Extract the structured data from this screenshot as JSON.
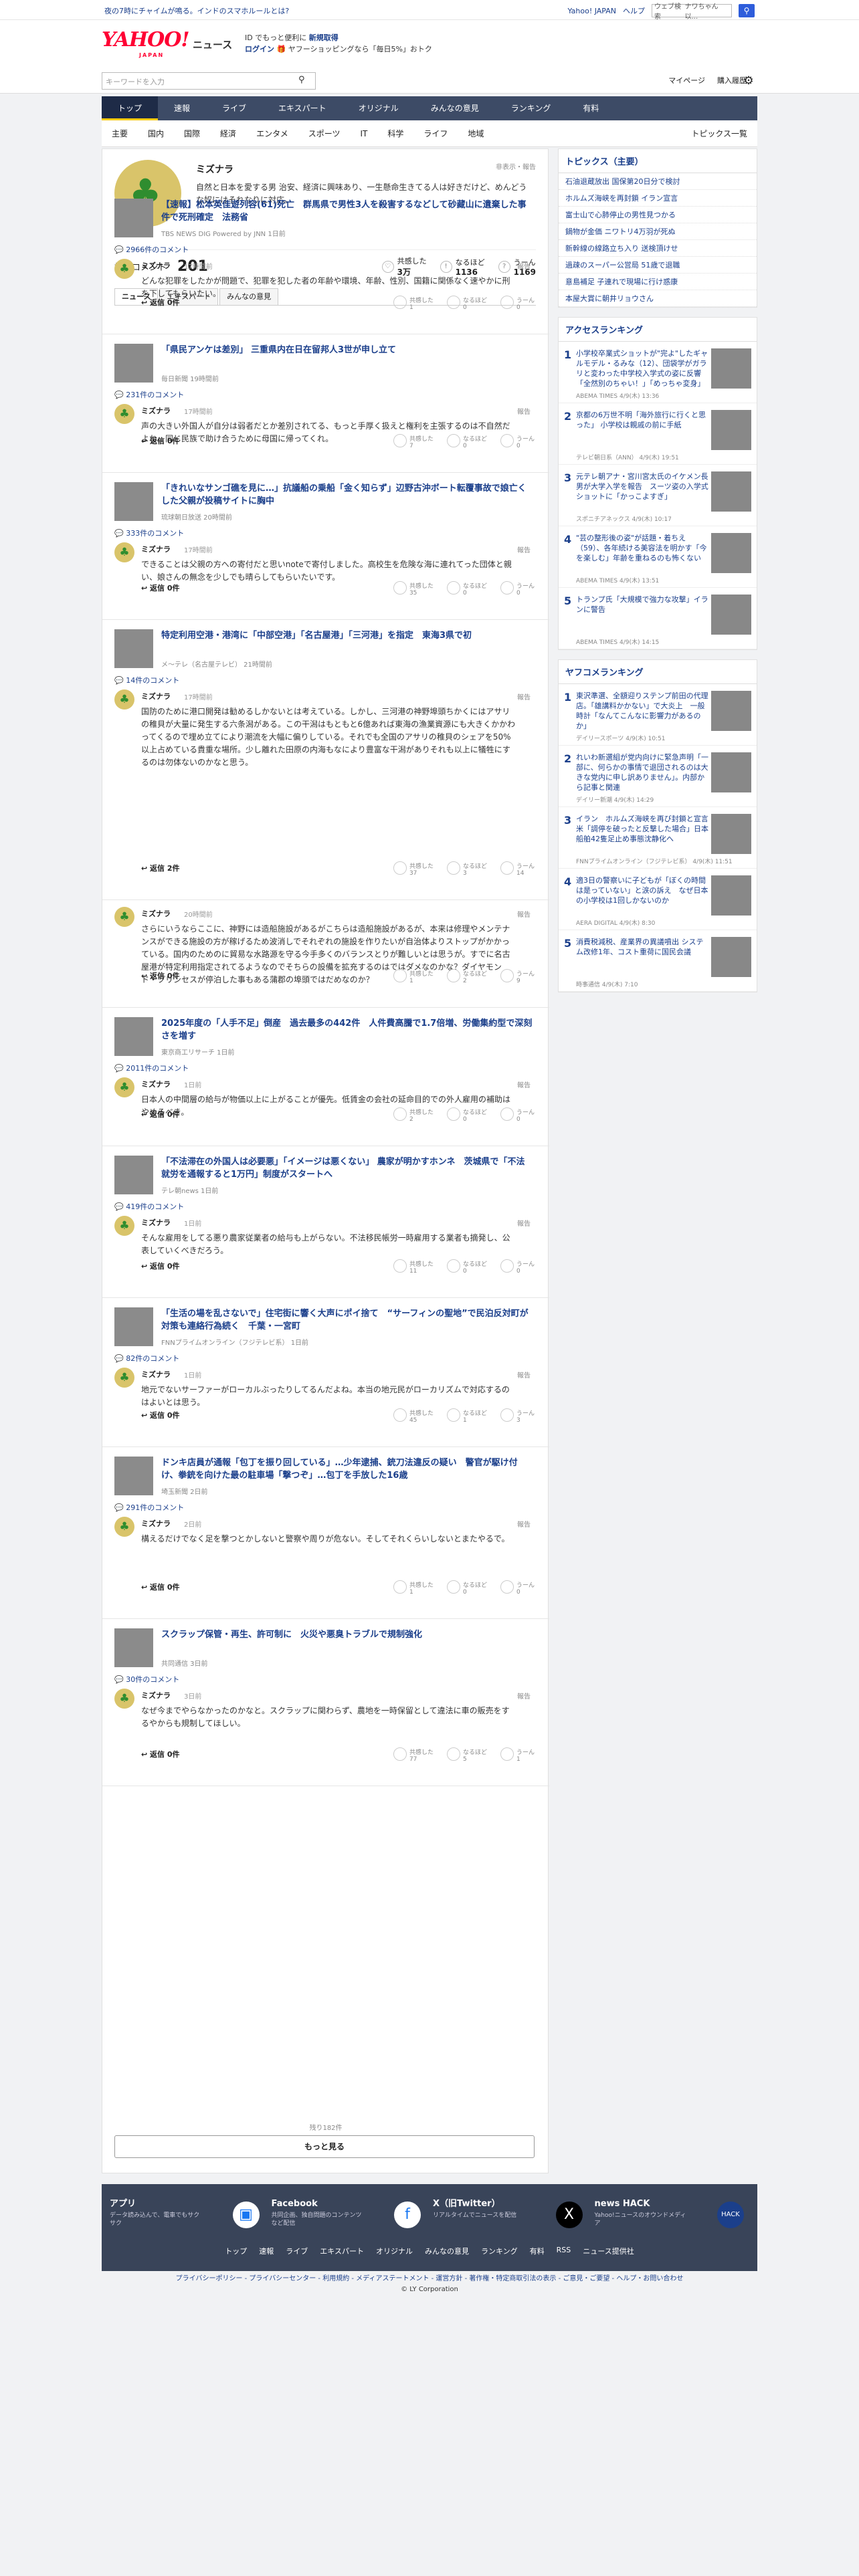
{
  "topbar": {
    "promo": "夜の7時にチャイムが鳴る。インドのスマホルールとは?",
    "links": [
      "Yahoo! JAPAN",
      "ヘルプ"
    ],
    "search_placeholder": "ウェブ検索",
    "search_value": "ナワちゃん 以..."
  },
  "header": {
    "logo": "YAHOO!",
    "logo_sub": "JAPAN",
    "service": "ニュース",
    "tag1": "ID でもっと便利に",
    "tag1_link": "新規取得",
    "tag2_login": "ログイン",
    "tag2": "ヤフーショッピングなら「毎日5%」おトク"
  },
  "search": {
    "placeholder": "キーワードを入力",
    "links": [
      "マイページ",
      "購入履歴"
    ]
  },
  "gnav": [
    "トップ",
    "速報",
    "ライブ",
    "エキスパート",
    "オリジナル",
    "みんなの意見",
    "ランキング",
    "有料"
  ],
  "snav": [
    "主要",
    "国内",
    "国際",
    "経済",
    "エンタメ",
    "スポーツ",
    "IT",
    "科学",
    "ライフ",
    "地域"
  ],
  "snav_all": "トピックス一覧",
  "profile": {
    "name": "ミズナラ",
    "report": "非表示・報告",
    "bio": "自然と日本を愛する男 治安、経済に興味あり、一生懸命生きてる人は好きだけど、めんどうな奴にはそれなりに対応。",
    "comments_label": "投稿コメント",
    "comments_count": "201",
    "reactions": [
      {
        "label": "共感した",
        "count": "3万"
      },
      {
        "label": "なるほど",
        "count": "1136"
      },
      {
        "label": "うーん",
        "count": "1169"
      }
    ]
  },
  "tabs": [
    "ニュース",
    "エキスパート",
    "みんなの意見"
  ],
  "reaction_labels": [
    "共感した",
    "なるほど",
    "うーん"
  ],
  "items": [
    {
      "title": "【速報】松本英佳遊列容(61)死亡　群馬県で男性3人を殺害するなどして砂藏山に遺棄した事件で死刑確定　法務省",
      "source": "TBS NEWS DIG Powered by JNN 1日前",
      "count": "2966件のコメント",
      "user": "ミズナラ",
      "time": "17時間前",
      "body": "どんな犯罪をしたかが問題で、犯罪を犯した者の年齢や環境、年齢、性別、国籍に関係なく速やかに刑を下してもらいたい。",
      "reply": "返信 0件",
      "r": [
        "1",
        "0",
        "0"
      ]
    },
    {
      "title": "「県民アンケは差別」 三重県内在日在留邦人3世が申し立て",
      "source": "毎日新聞 19時間前",
      "count": "231件のコメント",
      "user": "ミズナラ",
      "time": "17時間前",
      "body": "声の大きい外国人が自分は弱者だとか差別されてる、もっと手厚く扱えと権利を主張するのは不自然だよね。同じ民族で助け合うために母国に帰ってくれ。",
      "reply": "返信 0件",
      "r": [
        "7",
        "0",
        "0"
      ]
    },
    {
      "title": "「きれいなサンゴ礁を見に…」抗議船の乗船「金く知らず」辺野古沖ボート転覆事故で娘亡くした父親が投稿サイトに胸中",
      "source": "琉球朝日放送 20時間前",
      "count": "333件のコメント",
      "user": "ミズナラ",
      "time": "17時間前",
      "body": "できることは父親の方への寄付だと思いnoteで寄付しました。高校生を危険な海に連れてった団体と親い、娘さんの無念を少しでも晴らしてもらいたいです。",
      "reply": "返信 0件",
      "r": [
        "35",
        "0",
        "0"
      ]
    },
    {
      "title": "特定利用空港・港湾に「中部空港」「名古屋港」「三河港」を指定　東海3県で初",
      "source": "メ～テレ（名古屋テレビ） 21時間前",
      "count": "14件のコメント",
      "user": "ミズナラ",
      "time": "17時間前",
      "body": "国防のために港口開発は勧めるしかないとは考えている。しかし、三河港の神野埠頭ちかくにはアサリの稚貝が大量に発生する六条潟がある。この干潟はもともと6億あれば東海の漁業資源にも大きくかかわってくるので埋め立てにより潮流を大幅に偏りしている。それでも全国のアサリの稚貝のシェアを50%以上占めている貴重な場所。少し離れた田原の内海もなにより豊富な干潟がありそれも以上に犠牲にするのは勿体ないのかなと思う。",
      "reply": "返信 2件",
      "r": [
        "37",
        "3",
        "14"
      ]
    },
    {
      "title": "",
      "source": "",
      "count": "",
      "user": "ミズナラ",
      "time": "20時間前",
      "body": "さらにいうならここに、神野には造船施設があるがこちらは造船施設があるが、本来は修理やメンテナンスができる施設の方が稼げるため波消しでそれぞれの施設を作りたいが自治体よりストップがかかっている。国内のためのに貿易な水路源を守る今手多くのバランスとりが難しいとは思うが。すでに名古屋港が特定利用指定されてるようなのでそちらの設備を拡充するのはではダメなのかな？ダイヤモンド・プリンセスが停泊した事もある蒲郡の埠頭ではだめなのか？",
      "reply": "返信 0件",
      "r": [
        "1",
        "2",
        "9"
      ]
    },
    {
      "title": "2025年度の「人手不足」倒産　過去最多の442件　人件費高騰で1.7倍増、労働集約型で深刻さを増す",
      "source": "東京商工リサーチ 1日前",
      "count": "2011件のコメント",
      "user": "ミズナラ",
      "time": "1日前",
      "body": "日本人の中間層の給与が物価以上に上がることが優先。低賃金の会社の延命目的での外人雇用の補助はやめるべき。",
      "reply": "返信 0件",
      "r": [
        "2",
        "0",
        "0"
      ]
    },
    {
      "title": "「不法滞在の外国人は必要悪」「イメージは悪くない」 農家が明かすホンネ　茨城県で「不法就労を通報すると1万円」制度がスタートへ",
      "source": "テレ朝news 1日前",
      "count": "419件のコメント",
      "user": "ミズナラ",
      "time": "1日前",
      "body": "そんな雇用をしてる悪り農家従業者の給与も上がらない。不法移民帳労一時雇用する業者も摘発し、公表していくべきだろう。",
      "reply": "返信 0件",
      "r": [
        "11",
        "0",
        "0"
      ]
    },
    {
      "title": "「生活の場を乱さないで」住宅街に響く大声にポイ捨て　“サーフィンの聖地”で民泊反対町が対策も連絡行為続く　千葉・一宮町",
      "source": "FNNプライムオンライン（フジテレビ系） 1日前",
      "count": "82件のコメント",
      "user": "ミズナラ",
      "time": "1日前",
      "body": "地元でないサーファーがローカルぶったりしてるんだよね。本当の地元民がローカリズムで対応するのはよいとは思う。",
      "reply": "返信 0件",
      "r": [
        "45",
        "1",
        "3"
      ]
    },
    {
      "title": "ドンキ店員が通報「包丁を振り回している」…少年逮捕、銃刀法違反の疑い　警官が駆け付け、拳銃を向けた最の駐車場「撃つぞ」…包丁を手放した16歳",
      "source": "埼玉新聞 2日前",
      "count": "291件のコメント",
      "user": "ミズナラ",
      "time": "2日前",
      "body": "構えるだけでなく足を撃つとかしないと警察や周りが危ない。そしてそれくらいしないとまたやるで。",
      "reply": "返信 0件",
      "r": [
        "1",
        "0",
        "0"
      ]
    },
    {
      "title": "スクラップ保管・再生、許可制に　火災や悪臭トラブルで規制強化",
      "source": "共同通信 3日前",
      "count": "30件のコメント",
      "user": "ミズナラ",
      "time": "3日前",
      "body": "なぜ今までやらなかったのかなと。スクラップに関わらず、農地を一時保留として違法に車の販売をするやからも規制してほしい。",
      "reply": "返信 0件",
      "r": [
        "77",
        "5",
        "1"
      ]
    }
  ],
  "remaining": "残り182件",
  "more_label": "もっと見る",
  "topics": {
    "title": "トピックス（主要）",
    "items": [
      "石油退蔵放出 国保第20日分で検討",
      "ホルムズ海峡を再封鎖 イラン宣言",
      "富士山で心肺停止の男性見つかる",
      "鍋物が金価 ニワトリ4万羽が死ぬ",
      "新幹線の線路立ち入り 送検頂けせ",
      "過疎のスーパー公営局 51歳で退職",
      "意島補足 子連れで現場に行け惑康",
      "本屋大賞に朝井リョウさん"
    ]
  },
  "access": {
    "title": "アクセスランキング",
    "items": [
      {
        "title": "小学校卒業式ショットが\"完よ\"したギャルモデル・るみな（12）、団袋学がガラリと変わった中学校入学式の姿に反響「全然別のちゃい！」「めっちゃ変身」",
        "src": "ABEMA TIMES 4/9(木) 13:36"
      },
      {
        "title": "京都の6万世不明「海外旅行に行くと思った」 小学校は親戚の前に手紙",
        "src": "テレビ朝日系（ANN） 4/9(木) 19:51"
      },
      {
        "title": "元テレ朝アナ・宮川宮太氏のイケメン長男が大学入学を報告　スーツ姿の入学式ショットに「かっこよすぎ」",
        "src": "スポニチアネックス 4/9(木) 10:17"
      },
      {
        "title": "\"芸の整形後の姿\"が話題・着ちえ（59）、各年続ける美容法を明かす「今を楽しむ」年齢を重ねるのも怖くない",
        "src": "ABEMA TIMES 4/9(木) 13:51"
      },
      {
        "title": "トランプ氏「大規模で強力な攻撃」イランに警告",
        "src": "ABEMA TIMES 4/9(木) 14:15"
      }
    ]
  },
  "yafoco": {
    "title": "ヤフコメランキング",
    "items": [
      {
        "title": "東沢準選、全額迎りステンプ前田の代理店。「雄講料かかない」で大炎上　一般時計「なんてこんなに影響力があるのか」",
        "src": "デイリースポーツ 4/9(木) 10:51"
      },
      {
        "title": "れいわ新選組が党内向けに緊急声明「一部に、何らかの事情で退団されるのは大きな党内に申し訳ありません」。内部から記事と関連",
        "src": "デイリー新潮 4/9(木) 14:29"
      },
      {
        "title": "イラン　ホルムズ海峡を再び封鎖と宣言　米「調停を破ったと反撃した場合」日本船舶42隻足止め事態沈静化へ",
        "src": "FNNプライムオンライン（フジテレビ系） 4/9(木) 11:51"
      },
      {
        "title": "適3日の警察いに子どもが「ぼくの時間は是っていない」と涙の訴え　なぜ日本の小学校は1回しかないのか",
        "src": "AERA DIGITAL 4/9(木) 8:30"
      },
      {
        "title": "消費税減税、産業界の異議噴出 システム改修1年、コスト重荷に国民会議",
        "src": "時事通信 4/9(木) 7:10"
      }
    ]
  },
  "footer": {
    "cards": [
      {
        "name": "アプリ",
        "desc": "データ読み込んで、電車でもサクサク"
      },
      {
        "name": "Facebook",
        "desc": "共同企画、独自問題のコンテンツなど配信"
      },
      {
        "name": "X（旧Twitter）",
        "desc": "リアルタイムでニュースを配信"
      },
      {
        "name": "news HACK",
        "desc": "Yahoo!ニュースのオウンドメディア"
      }
    ],
    "nav": [
      "トップ",
      "速報",
      "ライブ",
      "エキスパート",
      "オリジナル",
      "みんなの意見",
      "ランキング",
      "有料",
      "RSS",
      "ニュース提供社"
    ],
    "links": "プライバシーポリシー - プライバシーセンター - 利用規約 - メディアステートメント - 運営方針 - 著作権・特定商取引法の表示 - ご意見・ご要望 - ヘルプ・お問い合わせ",
    "copyright": "© LY Corporation"
  }
}
